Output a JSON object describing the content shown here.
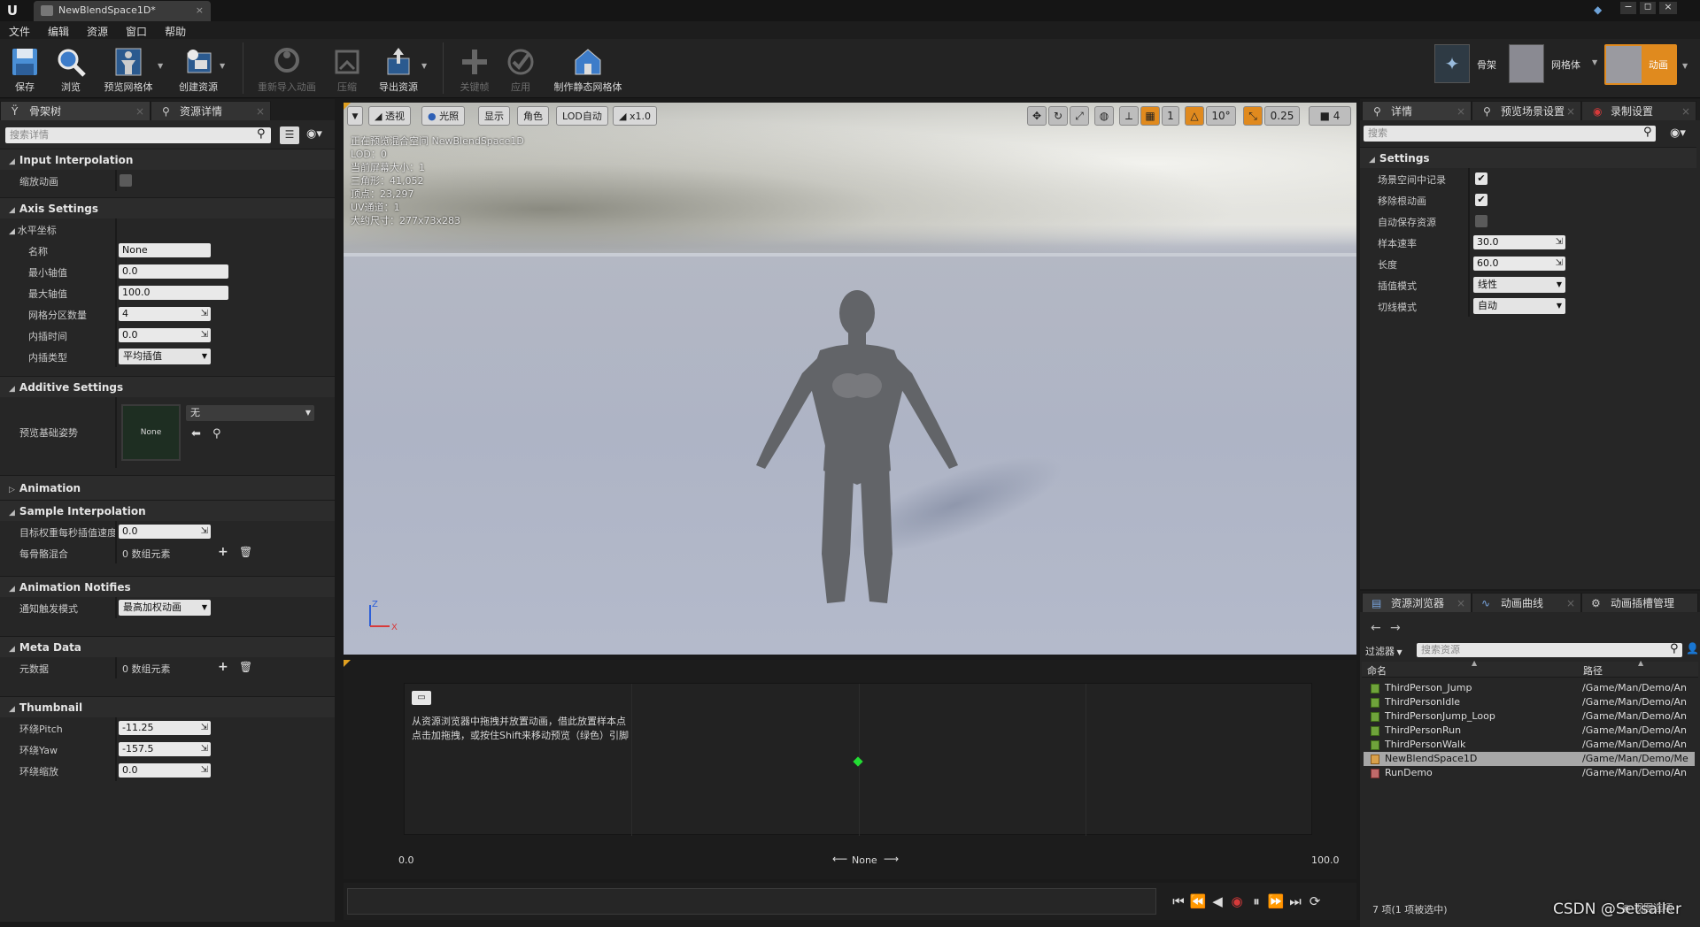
{
  "window": {
    "tab_title": "NewBlendSpace1D*"
  },
  "menu": [
    "文件",
    "编辑",
    "资源",
    "窗口",
    "帮助"
  ],
  "toolbar": {
    "buttons": [
      {
        "label": "保存",
        "enabled": true
      },
      {
        "label": "浏览",
        "enabled": true
      },
      {
        "label": "预览网格体",
        "enabled": true
      },
      {
        "label": "创建资源",
        "enabled": true
      },
      {
        "label": "重新导入动画",
        "enabled": false
      },
      {
        "label": "压缩",
        "enabled": false
      },
      {
        "label": "导出资源",
        "enabled": true
      },
      {
        "label": "关键帧",
        "enabled": false
      },
      {
        "label": "应用",
        "enabled": false
      },
      {
        "label": "制作静态网格体",
        "enabled": true
      }
    ],
    "modes": [
      {
        "label": "骨架"
      },
      {
        "label": "网格体"
      },
      {
        "label": "动画",
        "active": true
      }
    ]
  },
  "left": {
    "tabs": [
      "骨架树",
      "资源详情"
    ],
    "search_placeholder": "搜索详情",
    "sections": {
      "input_interpolation": {
        "title": "Input Interpolation",
        "scale_anim_label": "缩放动画",
        "scale_anim_checked": false
      },
      "axis_settings": {
        "title": "Axis Settings",
        "sub_title": "水平坐标",
        "rows": [
          {
            "label": "名称",
            "value": "None"
          },
          {
            "label": "最小轴值",
            "value": "0.0"
          },
          {
            "label": "最大轴值",
            "value": "100.0"
          },
          {
            "label": "网格分区数量",
            "value": "4"
          },
          {
            "label": "内插时间",
            "value": "0.0"
          },
          {
            "label": "内插类型",
            "value": "平均插值"
          }
        ]
      },
      "additive_settings": {
        "title": "Additive Settings",
        "label": "预览基础姿势",
        "thumb_text": "None",
        "value": "无"
      },
      "animation": {
        "title": "Animation"
      },
      "sample_interpolation": {
        "title": "Sample Interpolation",
        "rows": [
          {
            "label": "目标权重每秒插值速度",
            "value": "0.0"
          },
          {
            "label": "每骨骼混合",
            "value": "0 数组元素"
          }
        ]
      },
      "animation_notifies": {
        "title": "Animation Notifies",
        "label": "通知触发模式",
        "value": "最高加权动画"
      },
      "meta_data": {
        "title": "Meta Data",
        "label": "元数据",
        "value": "0 数组元素"
      },
      "thumbnail": {
        "title": "Thumbnail",
        "rows": [
          {
            "label": "环绕Pitch",
            "value": "-11.25"
          },
          {
            "label": "环绕Yaw",
            "value": "-157.5"
          },
          {
            "label": "环绕缩放",
            "value": "0.0"
          }
        ]
      }
    }
  },
  "viewport": {
    "buttons": [
      "透视",
      "光照",
      "显示",
      "角色",
      "LOD自动",
      "x1.0"
    ],
    "right_values": {
      "num1": "1",
      "angle": "10°",
      "scale": "0.25",
      "speed": "4"
    },
    "stats": [
      "正在预览混合空间 NewBlendSpace1D",
      "LOD：0",
      "当前屏幕大小：1",
      "三角形：41,052",
      "顶点：23,297",
      "UV通道：1",
      "大约尺寸：277x73x283"
    ],
    "axis": {
      "x": "X",
      "z": "Z"
    }
  },
  "blend_editor": {
    "hint_line1": "从资源浏览器中拖拽并放置动画，借此放置样本点",
    "hint_line2": "点击加拖拽，或按住Shift来移动预览（绿色）引脚",
    "min_label": "0.0",
    "max_label": "100.0",
    "axis_name": "None",
    "preview_value": 0.5
  },
  "right": {
    "tabs": [
      "详情",
      "预览场景设置",
      "录制设置"
    ],
    "search_placeholder": "搜索",
    "section_title": "Settings",
    "rows": [
      {
        "label": "场景空间中记录",
        "type": "check",
        "checked": true
      },
      {
        "label": "移除根动画",
        "type": "check",
        "checked": true
      },
      {
        "label": "自动保存资源",
        "type": "check",
        "checked": false
      },
      {
        "label": "样本速率",
        "type": "num",
        "value": "30.0"
      },
      {
        "label": "长度",
        "type": "num",
        "value": "60.0"
      },
      {
        "label": "插值模式",
        "type": "dd",
        "value": "线性"
      },
      {
        "label": "切线模式",
        "type": "dd",
        "value": "自动"
      }
    ]
  },
  "browser": {
    "tabs": [
      "资源浏览器",
      "动画曲线",
      "动画插槽管理"
    ],
    "filter_label": "过滤器",
    "search_placeholder": "搜索资源",
    "col_name": "命名",
    "col_path": "路径",
    "assets": [
      {
        "name": "ThirdPerson_Jump",
        "path": "/Game/Man/Demo/An"
      },
      {
        "name": "ThirdPersonIdle",
        "path": "/Game/Man/Demo/An"
      },
      {
        "name": "ThirdPersonJump_Loop",
        "path": "/Game/Man/Demo/An"
      },
      {
        "name": "ThirdPersonRun",
        "path": "/Game/Man/Demo/An"
      },
      {
        "name": "ThirdPersonWalk",
        "path": "/Game/Man/Demo/An"
      },
      {
        "name": "NewBlendSpace1D",
        "path": "/Game/Man/Demo/Me",
        "selected": true
      },
      {
        "name": "RunDemo",
        "path": "/Game/Man/Demo/An"
      }
    ],
    "status": "7 项(1 项被选中)",
    "view_options": "视图选项"
  },
  "watermark": "CSDN @Setsailer"
}
